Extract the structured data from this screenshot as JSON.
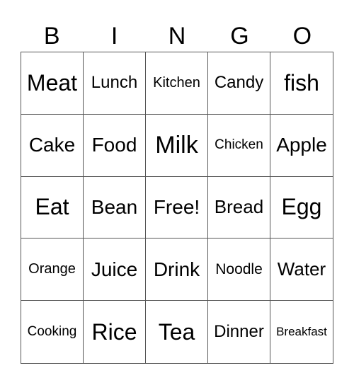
{
  "header": [
    "B",
    "I",
    "N",
    "G",
    "O"
  ],
  "cells": [
    [
      "Meat",
      "Lunch",
      "Kitchen",
      "Candy",
      "fish"
    ],
    [
      "Cake",
      "Food",
      "Milk",
      "Chicken",
      "Apple"
    ],
    [
      "Eat",
      "Bean",
      "Free!",
      "Bread",
      "Egg"
    ],
    [
      "Orange",
      "Juice",
      "Drink",
      "Noodle",
      "Water"
    ],
    [
      "Cooking",
      "Rice",
      "Tea",
      "Dinner",
      "Breakfast"
    ]
  ]
}
